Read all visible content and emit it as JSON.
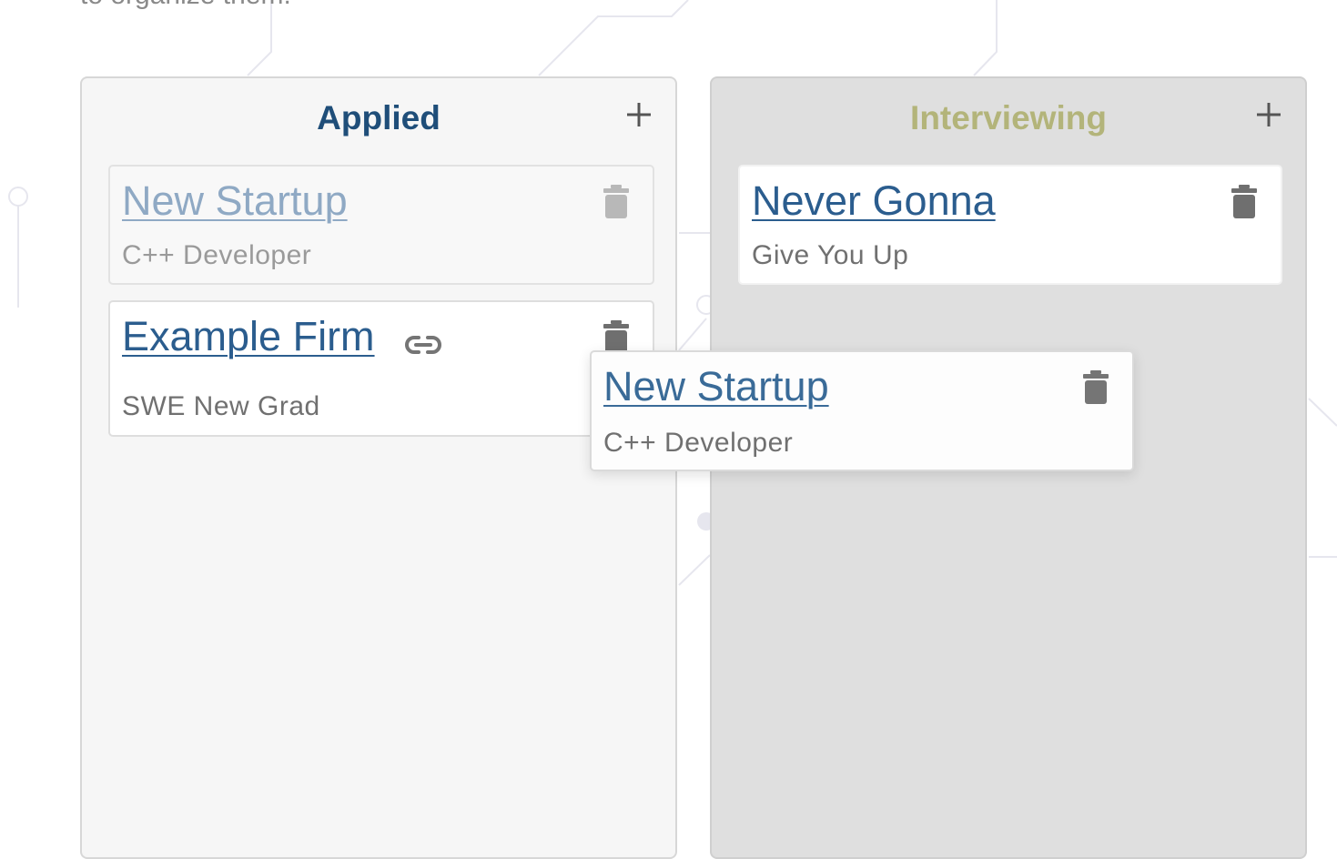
{
  "page": {
    "intro_text": "to organize them.",
    "colors": {
      "applied_title": "#1f4e79",
      "interviewing_title": "#b3b47a",
      "card_link": "#2b5d8e",
      "icon_gray": "#757575"
    }
  },
  "columns": [
    {
      "title": "Applied",
      "add_icon": "plus-icon",
      "cards": [
        {
          "company": "New Startup",
          "role": "C++ Developer",
          "state": "placeholder",
          "icon": "trash-icon"
        },
        {
          "company": "Example Firm",
          "role": "SWE New Grad",
          "has_link": true,
          "link_icon": "link-icon",
          "icon": "trash-icon"
        }
      ]
    },
    {
      "title": "Interviewing",
      "add_icon": "plus-icon",
      "cards": [
        {
          "company": "Never Gonna",
          "role": "Give You Up",
          "icon": "trash-icon"
        }
      ]
    }
  ],
  "dragging_card": {
    "company": "New Startup",
    "role": "C++ Developer",
    "icon": "trash-icon"
  }
}
